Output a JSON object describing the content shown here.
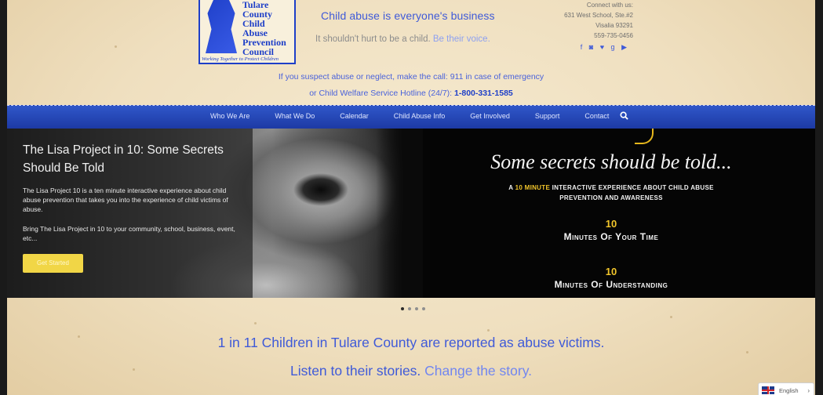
{
  "logo": {
    "name_lines": [
      "Tulare",
      "County",
      "Child",
      "Abuse",
      "Prevention",
      "Council"
    ],
    "tagline": "Working Together to Protect Children",
    "brand_color": "#1e3fc8"
  },
  "header": {
    "tagline_main": "Child abuse is everyone's business",
    "tagline_sub_plain": "It shouldn't hurt to be a child.",
    "tagline_sub_accent": "Be their voice."
  },
  "contact": {
    "heading": "Connect with us:",
    "address_line1": "631 West School, Ste.#2",
    "address_line2": "Visalia 93291",
    "phone": "559-735-0456",
    "social_icons": [
      "facebook-icon",
      "instagram-icon",
      "twitter-icon",
      "google-plus-icon",
      "youtube-icon"
    ],
    "social_glyphs": [
      "f",
      "◙",
      "♥",
      "g",
      "▶"
    ]
  },
  "callout": {
    "line1": "If you suspect abuse or neglect, make the call: 911 in case of emergency",
    "line2_plain": "or Child Welfare Service Hotline (24/7):",
    "line2_number": "1-800-331-1585"
  },
  "nav": {
    "items": [
      "Who We Are",
      "What We Do",
      "Calendar",
      "Child Abuse Info",
      "Get Involved",
      "Support",
      "Contact"
    ],
    "search_icon": "search-icon"
  },
  "hero": {
    "title": "The Lisa Project in 10: Some Secrets Should Be Told",
    "text1": "The Lisa Project 10 is a ten minute interactive experience about child abuse prevention that takes you into the experience of child victims of abuse.",
    "text2": "Bring The Lisa Project in 10 to your community, school, business, event, etc...",
    "cta_label": "Get Started",
    "graphic": {
      "headline": "Some secrets should be told...",
      "sub_line1_prefix": "A",
      "sub_line1_accent": "10 MINUTE",
      "sub_line1_suffix": "INTERACTIVE EXPERIENCE ABOUT CHILD ABUSE",
      "sub_line2": "PREVENTION AND AWARENESS",
      "number1": "10",
      "label1": "Minutes Of Your Time",
      "number2": "10",
      "label2": "Minutes Of Understanding"
    }
  },
  "carousel": {
    "slide_count": 4,
    "active_index": 0
  },
  "stats": {
    "line1": "1 in 11 Children in Tulare County are reported as abuse victims.",
    "line2_plain": "Listen to their stories.",
    "line2_accent": "Change the story."
  },
  "language": {
    "label": "English",
    "arrow": "›"
  },
  "colors": {
    "accent_blue": "#3f5ad8",
    "nav_blue": "#2f57c9",
    "cta_yellow": "#f1d646",
    "highlight_gold": "#f1c52b"
  }
}
